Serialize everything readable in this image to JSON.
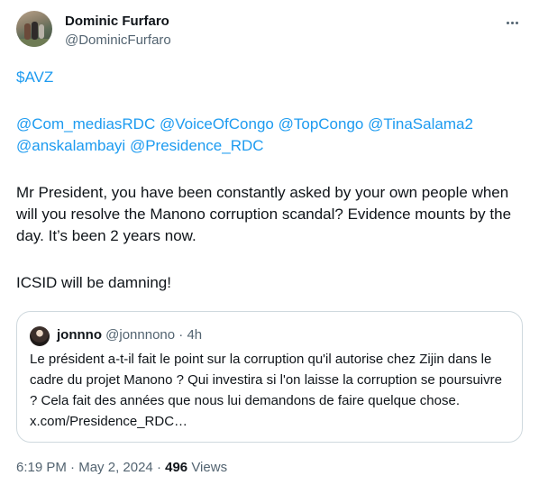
{
  "author": {
    "name": "Dominic Furfaro",
    "handle": "@DominicFurfaro"
  },
  "more_icon": "more-horizontal-icon",
  "tweet": {
    "cashtag": "$AVZ",
    "mentions_line1": [
      "@Com_mediasRDC",
      "@VoiceOfCongo",
      "@TopCongo",
      "@TinaSalama2"
    ],
    "mentions_line2": [
      "@anskalambayi",
      "@Presidence_RDC"
    ],
    "paragraph": "Mr President, you have been constantly asked by your own people when will you resolve the Manono corruption scandal? Evidence mounts by the day. It’s been 2 years now.",
    "closing": "ICSID will be damning!"
  },
  "quoted_tweet": {
    "name": "jonnno",
    "handle": "@jonnnono",
    "separator": "·",
    "time": "4h",
    "text": "Le président a-t-il fait le point sur la corruption qu'il autorise chez Zijin dans le cadre du projet Manono ? Qui investira si l'on laisse la corruption se poursuivre ? Cela fait des années que nous lui demandons de faire quelque chose. x.com/Presidence_RDC…"
  },
  "meta": {
    "time": "6:19 PM",
    "separator": "·",
    "date": "May 2, 2024",
    "views_count": "496",
    "views_label": "Views"
  },
  "colors": {
    "link": "#1d9bf0",
    "text": "#0f1419",
    "secondary": "#536471",
    "border": "#cfd9de"
  }
}
